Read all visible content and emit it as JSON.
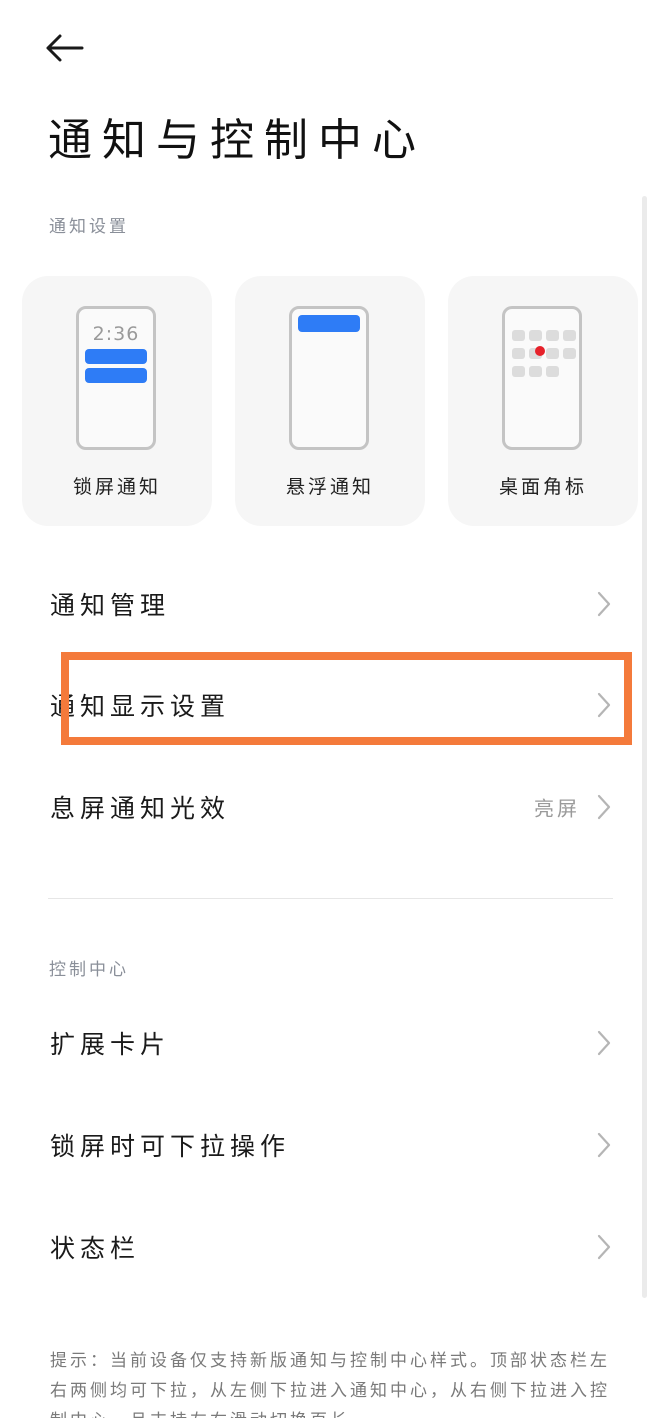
{
  "header": {
    "title": "通知与控制中心"
  },
  "notification_section": {
    "label": "通知设置",
    "cards": [
      {
        "label": "锁屏通知",
        "icon": "lockscreen-preview-icon",
        "preview_time": "2:36"
      },
      {
        "label": "悬浮通知",
        "icon": "floating-preview-icon"
      },
      {
        "label": "桌面角标",
        "icon": "badge-preview-icon"
      }
    ],
    "rows": [
      {
        "label": "通知管理",
        "value": ""
      },
      {
        "label": "通知显示设置",
        "value": ""
      },
      {
        "label": "息屏通知光效",
        "value": "亮屏"
      }
    ]
  },
  "control_section": {
    "label": "控制中心",
    "rows": [
      {
        "label": "扩展卡片"
      },
      {
        "label": "锁屏时可下拉操作"
      },
      {
        "label": "状态栏"
      }
    ]
  },
  "tip": {
    "text": "提示：当前设备仅支持新版通知与控制中心样式。顶部状态栏左右两侧均可下拉，从左侧下拉进入通知中心，从右侧下拉进入控制中心，且支持左右滑动切换页长。"
  },
  "colors": {
    "accent_blue": "#2e7cf6",
    "badge_red": "#e6212a",
    "highlight_orange": "#f47a3b",
    "secondary_text": "#8a8f99"
  }
}
